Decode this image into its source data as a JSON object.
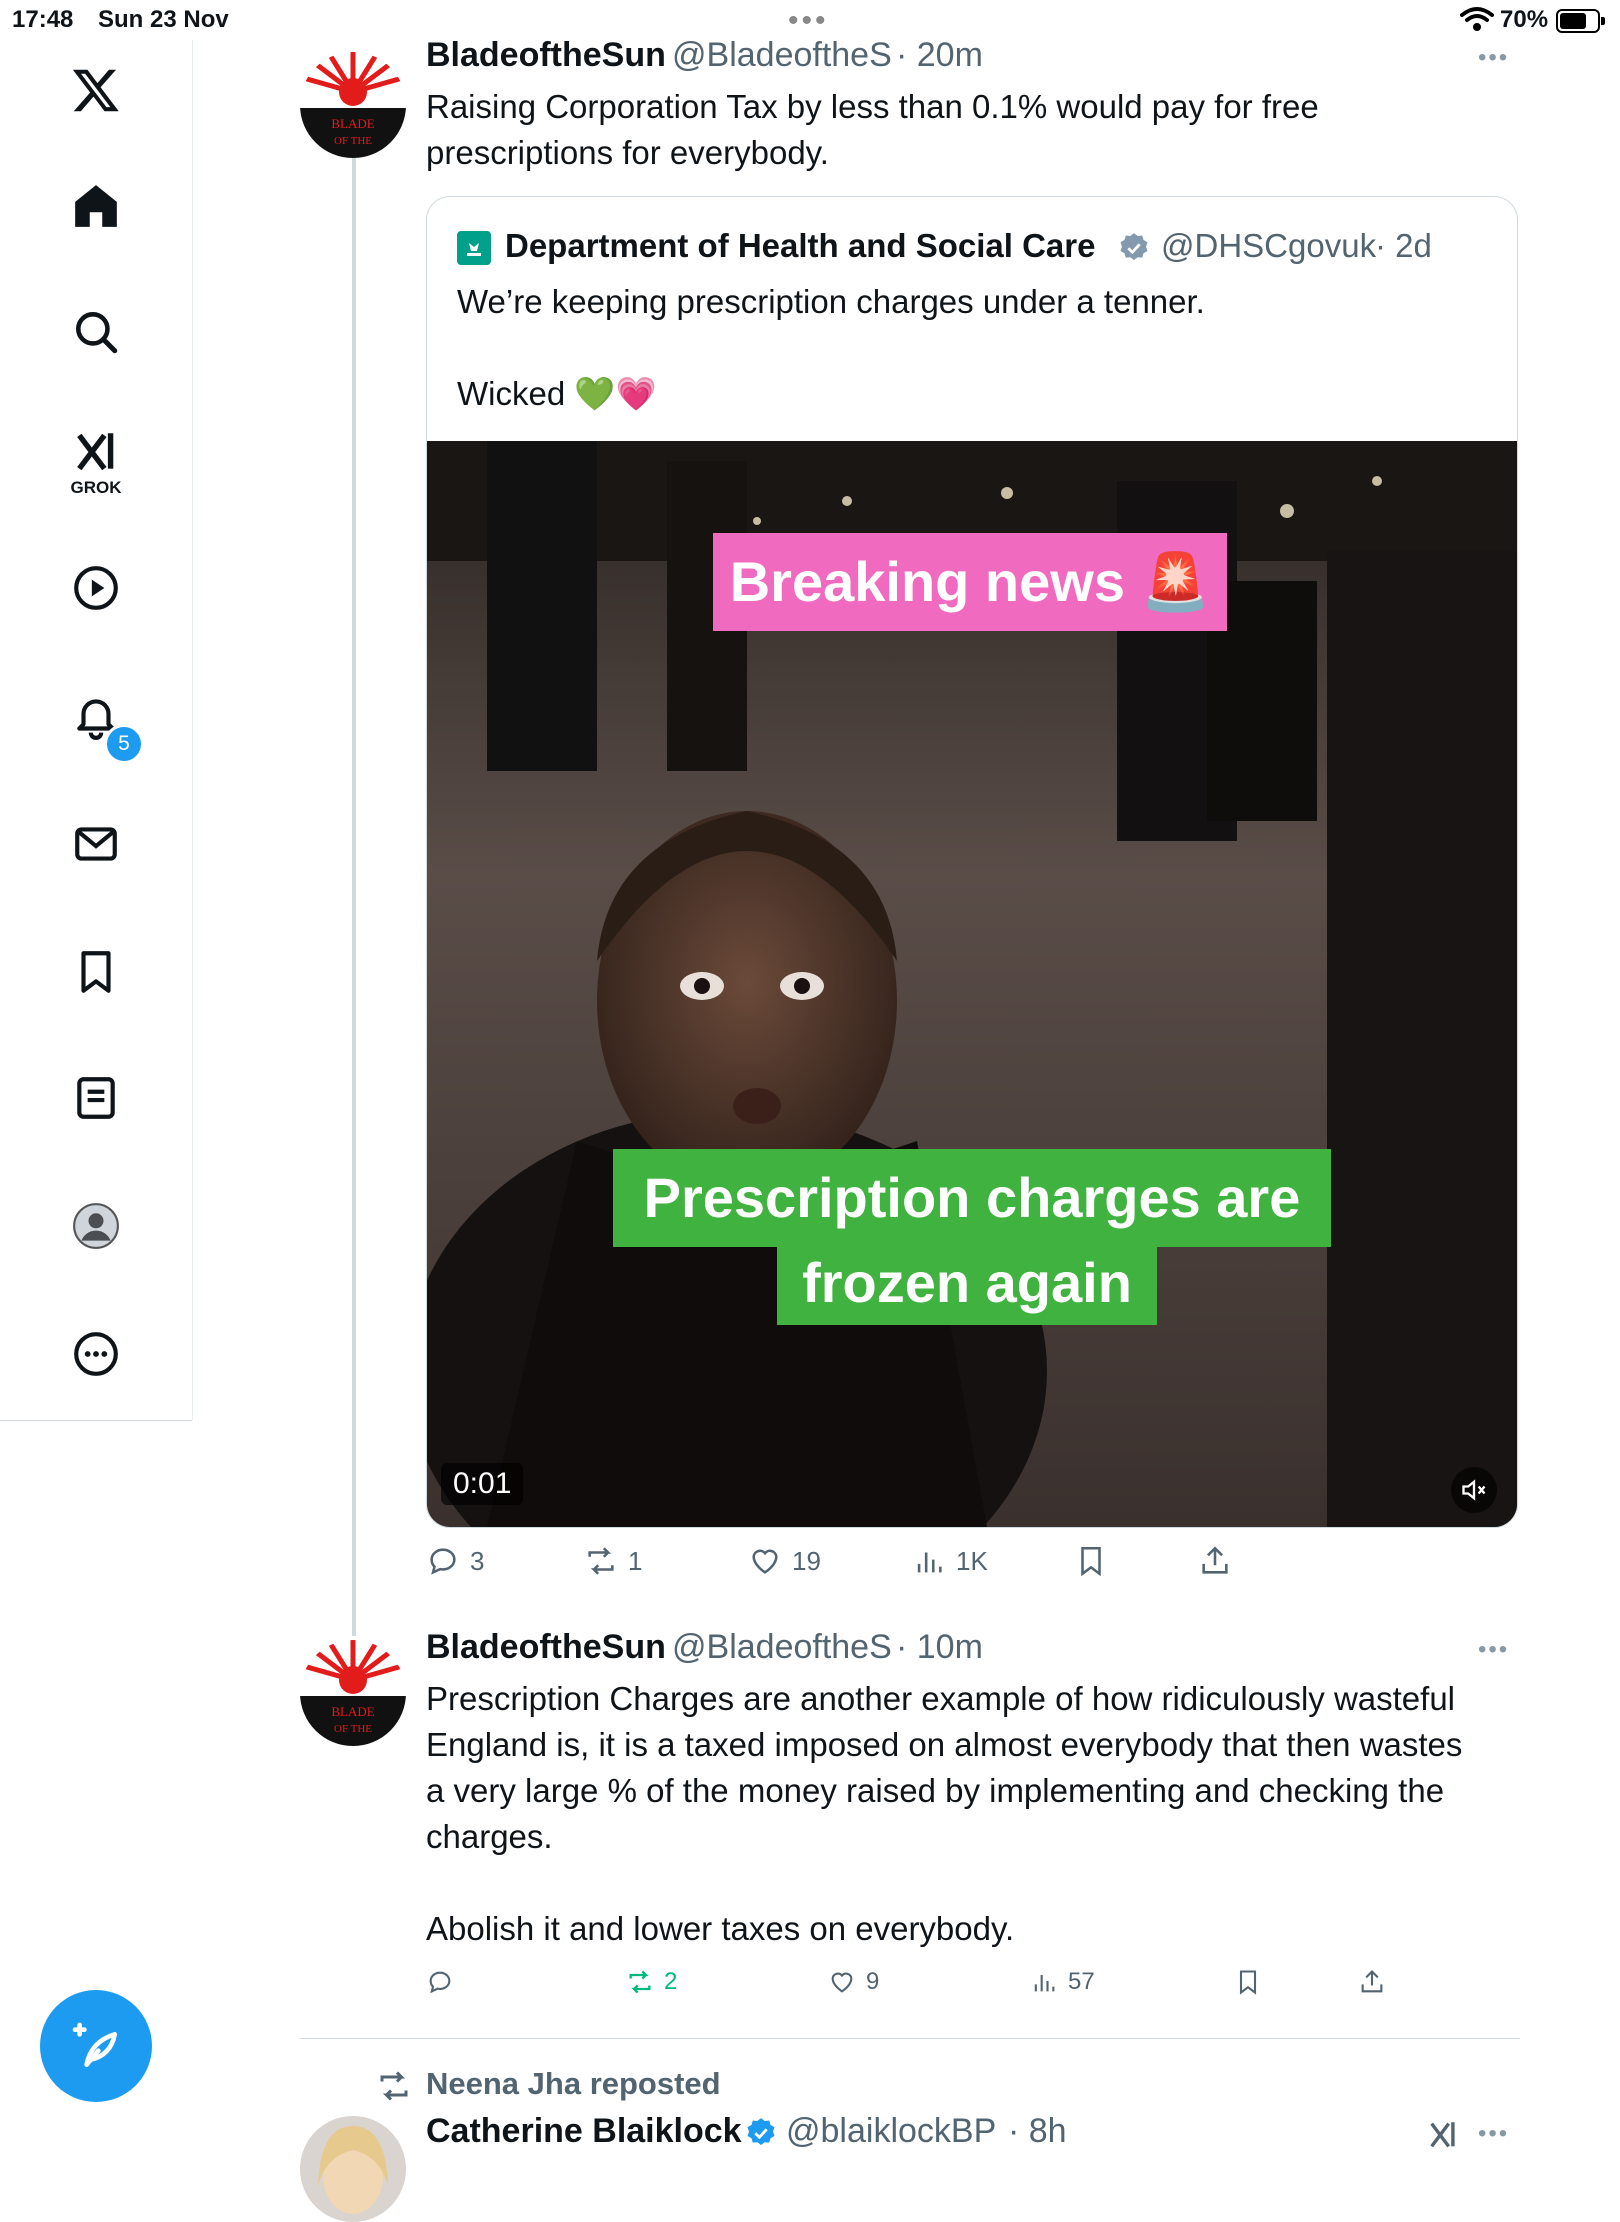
{
  "status": {
    "time": "17:48",
    "date": "Sun 23 Nov",
    "battery": "70%"
  },
  "sidebar": {
    "items": [
      {
        "name": "x-logo"
      },
      {
        "name": "home"
      },
      {
        "name": "search"
      },
      {
        "name": "grok",
        "label": "GROK"
      },
      {
        "name": "videos"
      },
      {
        "name": "notifications",
        "badge": "5"
      },
      {
        "name": "messages"
      },
      {
        "name": "bookmarks"
      },
      {
        "name": "lists"
      },
      {
        "name": "profile"
      },
      {
        "name": "more"
      }
    ]
  },
  "tweet1": {
    "name": "BladeoftheSun",
    "handle": "@BladeoftheS",
    "time": "· 20m",
    "text_line1": "Raising Corporation Tax by less than 0.1% would pay for free",
    "text_line2": "prescriptions for everybody.",
    "quote": {
      "name": "Department of Health and Social Care",
      "handle": "@DHSCgovuk",
      "time": "· 2d",
      "text_line1": "We’re keeping prescription charges under a tenner.",
      "text_line2": "Wicked 💚💗",
      "video": {
        "caption_top": "Breaking news 🚨",
        "caption_line1": "Prescription charges are",
        "caption_line2": "frozen again",
        "timestamp": "0:01"
      }
    },
    "actions": {
      "replies": "3",
      "reposts": "1",
      "likes": "19",
      "views": "1K"
    }
  },
  "tweet2": {
    "name": "BladeoftheSun",
    "handle": "@BladeoftheS",
    "time": "· 10m",
    "lines": [
      "Prescription Charges are another example of how ridiculously wasteful",
      "England is, it is a taxed imposed on almost everybody that then wastes",
      "a very large % of the money raised by implementing and checking the",
      "charges.",
      "",
      "Abolish it and lower taxes on everybody."
    ],
    "actions": {
      "replies": "",
      "reposts": "2",
      "likes": "9",
      "views": "57"
    }
  },
  "tweet3": {
    "repost_label": "Neena Jha reposted",
    "name": "Catherine Blaiklock",
    "handle": "@blaiklockBP",
    "time": "· 8h"
  },
  "colors": {
    "accent": "#1d9bf0",
    "repost_active": "#00ba7c",
    "verified": "#829aab",
    "caption_pink": "#f06ac0",
    "caption_green": "#3fb23f"
  }
}
